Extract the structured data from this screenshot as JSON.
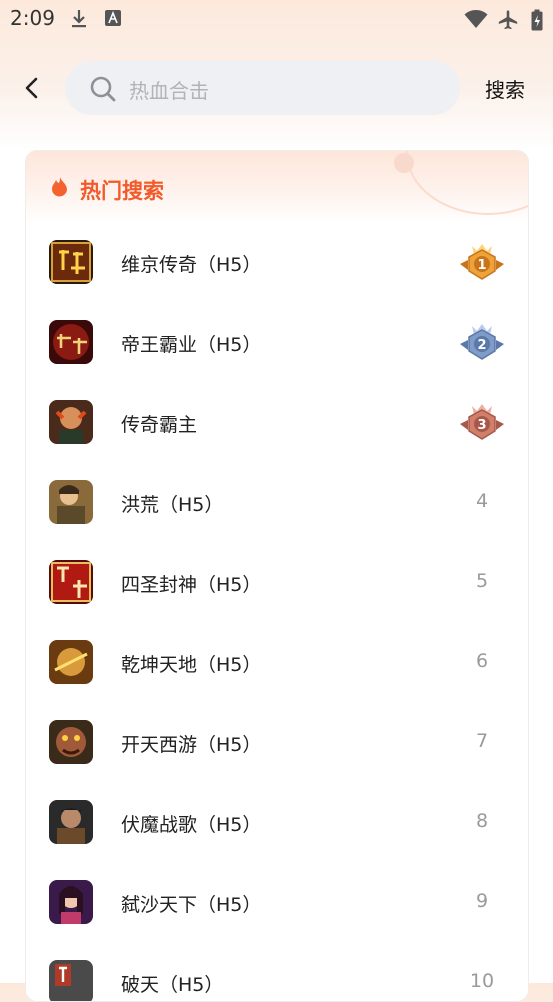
{
  "status_bar": {
    "time": "2:09"
  },
  "header": {
    "search_placeholder": "热血合击",
    "search_button": "搜索"
  },
  "hot": {
    "title": "热门搜索",
    "items": [
      {
        "name": "维京传奇（H5）",
        "rank": "1",
        "medal": "gold"
      },
      {
        "name": "帝王霸业（H5）",
        "rank": "2",
        "medal": "silver"
      },
      {
        "name": "传奇霸主",
        "rank": "3",
        "medal": "bronze"
      },
      {
        "name": "洪荒（H5）",
        "rank": "4"
      },
      {
        "name": "四圣封神（H5）",
        "rank": "5"
      },
      {
        "name": "乾坤天地（H5）",
        "rank": "6"
      },
      {
        "name": "开天西游（H5）",
        "rank": "7"
      },
      {
        "name": "伏魔战歌（H5）",
        "rank": "8"
      },
      {
        "name": "弑沙天下（H5）",
        "rank": "9"
      },
      {
        "name": "破天（H5）",
        "rank": "10"
      }
    ]
  }
}
